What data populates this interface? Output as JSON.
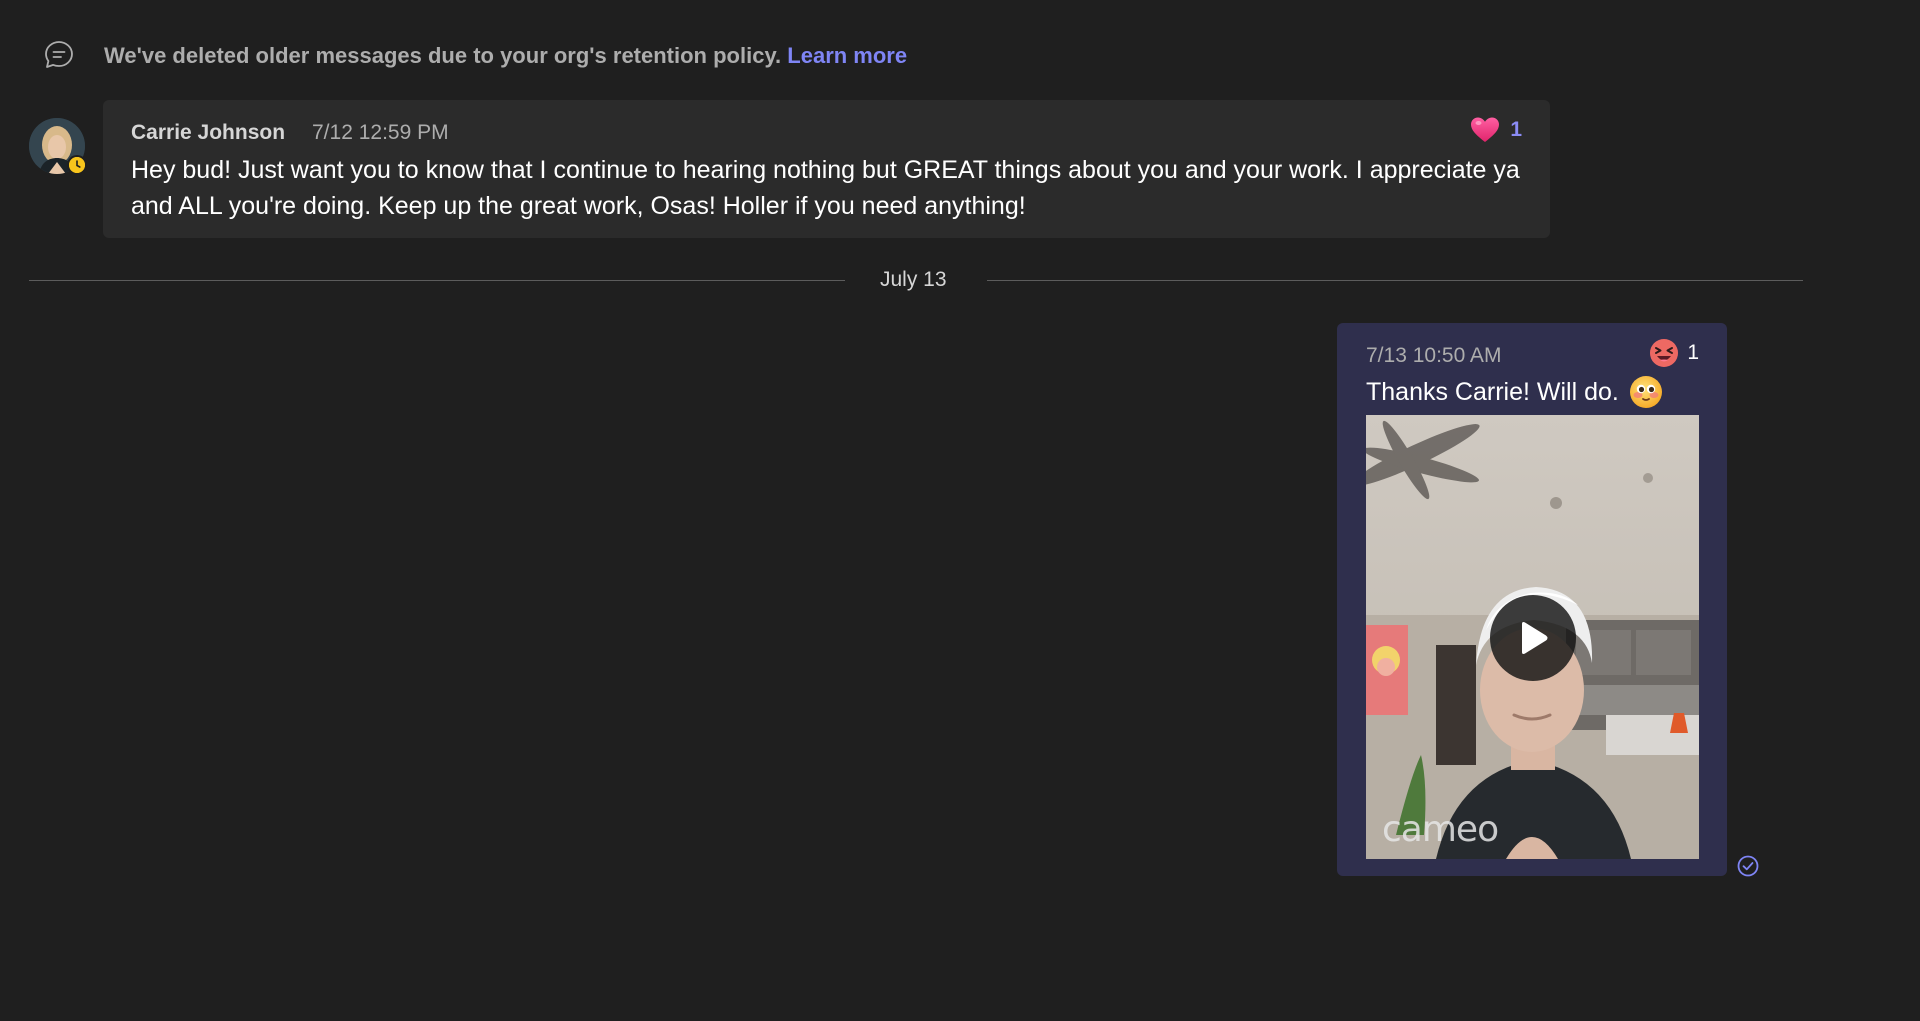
{
  "notice": {
    "icon": "chat-bubble-icon",
    "text": "We've deleted older messages due to your org's retention policy.",
    "link": "Learn more"
  },
  "incoming_message": {
    "sender": "Carrie Johnson",
    "timestamp": "7/12 12:59 PM",
    "body": "Hey bud! Just want you to know that I continue to hearing nothing but GREAT things about you and your work. I appreciate ya and ALL you're doing. Keep up the great work, Osas! Holler if you need anything!",
    "reaction": {
      "icon": "heart-icon",
      "count": "1"
    },
    "presence": "away"
  },
  "date_divider": {
    "label": "July 13"
  },
  "outgoing_message": {
    "timestamp": "7/13 10:50 AM",
    "body": "Thanks Carrie! Will do.",
    "body_emoji": "blushing-face-icon",
    "reaction": {
      "icon": "laughing-face-icon",
      "count": "1"
    },
    "video": {
      "watermark": "cameo",
      "play_icon": "play-icon"
    },
    "status_icon": "read-receipt-icon"
  },
  "colors": {
    "background": "#1f1f1f",
    "incoming_bubble": "#2b2b2b",
    "outgoing_bubble": "#2f2f4d",
    "accent": "#7f85f5",
    "presence_away": "#f8c51c"
  }
}
